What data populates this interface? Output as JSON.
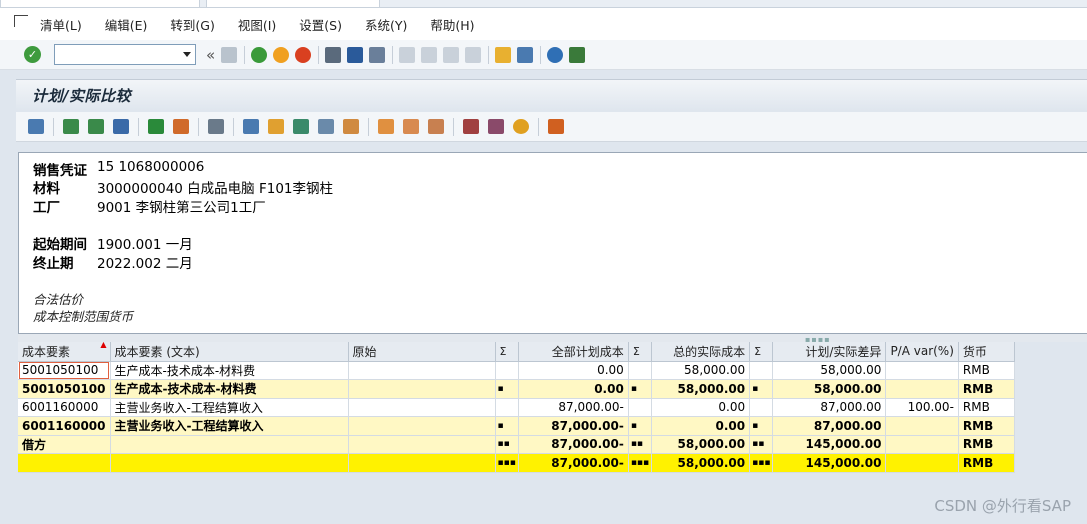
{
  "menu": [
    "清单(L)",
    "编辑(E)",
    "转到(G)",
    "视图(I)",
    "设置(S)",
    "系统(Y)",
    "帮助(H)"
  ],
  "toolbar": {
    "command_value": ""
  },
  "title": "计划/实际比较",
  "header": {
    "rows": [
      {
        "label": "销售凭证",
        "value": "15 1068000006"
      },
      {
        "label": "材料",
        "value": "3000000040 白成品电脑  F101李钢柱"
      },
      {
        "label": "工厂",
        "value": "9001 李钢柱第三公司1工厂"
      },
      {
        "label": "起始期间",
        "value": "1900.001 一月"
      },
      {
        "label": "终止期",
        "value": "2022.002 二月"
      }
    ],
    "notes": [
      "合法估价",
      "成本控制范围货币"
    ]
  },
  "grid": {
    "columns": [
      "成本要素",
      "成本要素 (文本)",
      "原始",
      "Σ",
      "全部计划成本",
      "Σ",
      "总的实际成本",
      "Σ",
      "计划/实际差异",
      "P/A var(%)",
      "货币"
    ],
    "rows": [
      {
        "type": "item",
        "cells": [
          "5001050100",
          "生产成本-技术成本-材料费",
          "",
          "",
          "0.00",
          "",
          "58,000.00",
          "",
          "58,000.00",
          "",
          "RMB"
        ]
      },
      {
        "type": "sub",
        "cells": [
          "5001050100",
          "生产成本-技术成本-材料费",
          "",
          "▪",
          "0.00",
          "▪",
          "58,000.00",
          "▪",
          "58,000.00",
          "",
          "RMB"
        ]
      },
      {
        "type": "item",
        "cells": [
          "6001160000",
          "主营业务收入-工程结算收入",
          "",
          "",
          "87,000.00-",
          "",
          "0.00",
          "",
          "87,000.00",
          "100.00-",
          "RMB"
        ]
      },
      {
        "type": "sub",
        "cells": [
          "6001160000",
          "主营业务收入-工程结算收入",
          "",
          "▪",
          "87,000.00-",
          "▪",
          "0.00",
          "▪",
          "87,000.00",
          "",
          "RMB"
        ]
      },
      {
        "type": "sub",
        "cells": [
          "借方",
          "",
          "",
          "▪▪",
          "87,000.00-",
          "▪▪",
          "58,000.00",
          "▪▪",
          "145,000.00",
          "",
          "RMB"
        ]
      },
      {
        "type": "tot",
        "cells": [
          "",
          "",
          "",
          "▪▪▪",
          "87,000.00-",
          "▪▪▪",
          "58,000.00",
          "▪▪▪",
          "145,000.00",
          "",
          "RMB"
        ]
      }
    ]
  },
  "watermark": "CSDN @外行看SAP"
}
